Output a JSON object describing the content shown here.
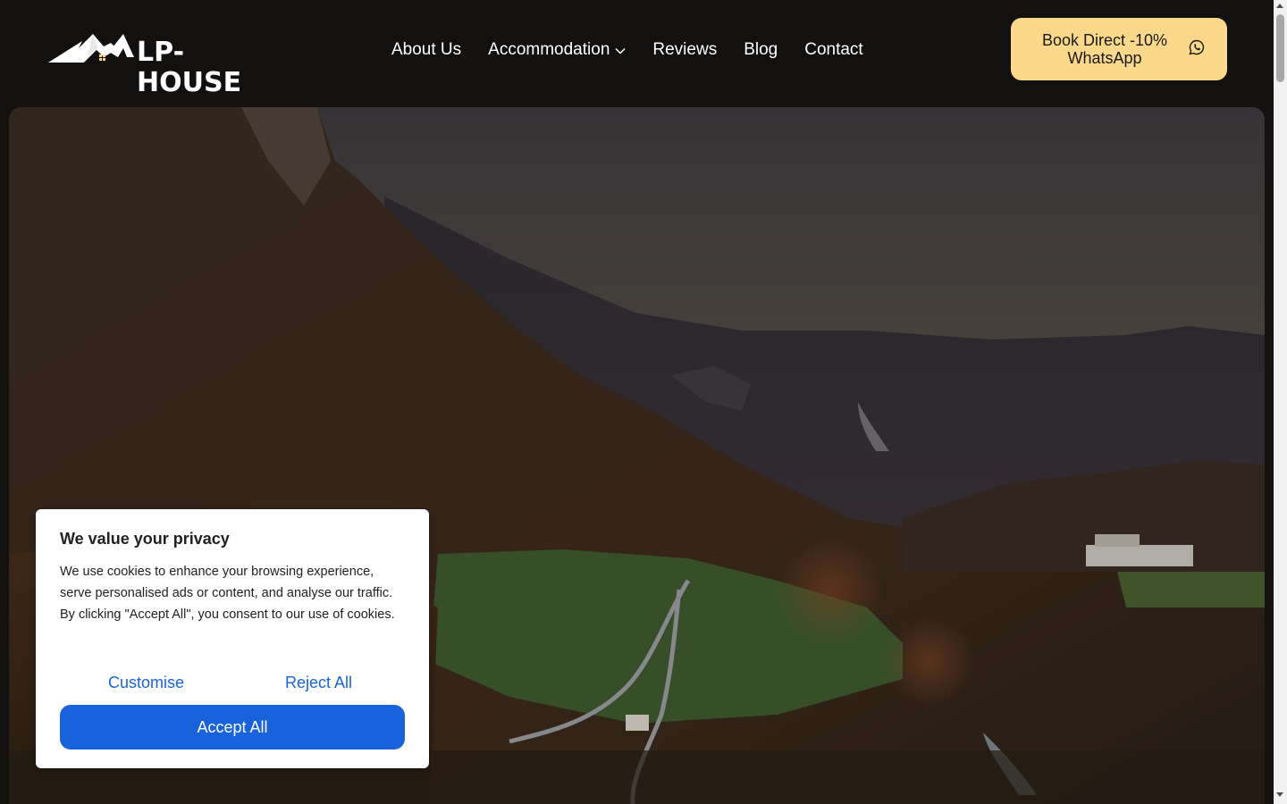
{
  "header": {
    "logo_text": "LP-HOUSE",
    "nav": {
      "about": "About Us",
      "accommodation": "Accommodation",
      "reviews": "Reviews",
      "blog": "Blog",
      "contact": "Contact"
    },
    "cta_label": "Book Direct -10% WhatsApp",
    "cta_icon": "whatsapp-icon"
  },
  "hero": {
    "image_subject": "autumn mountain valley with winding road"
  },
  "cookie_banner": {
    "title": "We value your privacy",
    "text": "We use cookies to enhance your browsing experience, serve personalised ads or content, and analyse our traffic. By clicking \"Accept All\", you consent to our use of cookies.",
    "customise_label": "Customise",
    "reject_label": "Reject All",
    "accept_label": "Accept All"
  },
  "colors": {
    "header_bg": "#121110",
    "cta_bg": "#fcd98a",
    "cookie_accent": "#1863dc"
  }
}
